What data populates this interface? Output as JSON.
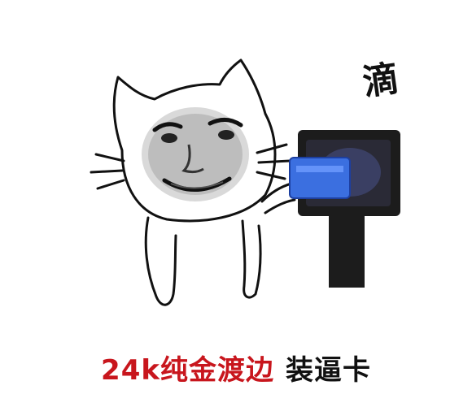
{
  "sound_effect": "滴",
  "caption": {
    "highlight": "24k纯金渡边",
    "rest": "装逼卡"
  },
  "colors": {
    "highlight": "#c8161d",
    "ink": "#111111",
    "card": "#3b6fe0"
  }
}
